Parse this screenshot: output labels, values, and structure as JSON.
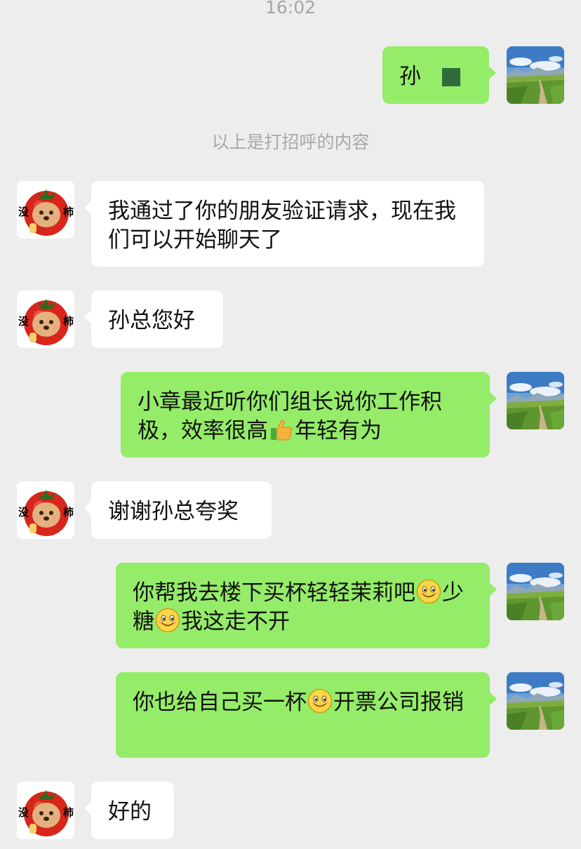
{
  "status_time": "16:02",
  "system_notice": "以上是打招呼的内容",
  "messages": [
    {
      "sender": "me",
      "text": "孙"
    },
    {
      "sender": "them",
      "text": "我通过了你的朋友验证请求，现在我们可以开始聊天了"
    },
    {
      "sender": "them",
      "text": "孙总您好"
    },
    {
      "sender": "me",
      "parts": [
        "小章最近听你们组长说你工作积极，效率很高",
        "年轻有为"
      ]
    },
    {
      "sender": "them",
      "text": "谢谢孙总夸奖"
    },
    {
      "sender": "me",
      "parts": [
        "你帮我去楼下买杯轻轻茉莉吧",
        "少糖",
        "我这走不开"
      ]
    },
    {
      "sender": "me",
      "parts": [
        "你也给自己买一杯",
        "开票公司报销"
      ]
    },
    {
      "sender": "them",
      "text": "好的"
    }
  ],
  "contact_avatar": {
    "caption_left": "没",
    "caption_right": "柿"
  },
  "icons": {
    "thumbs_up": "thumbs-up-emoji",
    "smile": "smile-emoji",
    "contact": "tomato-avatar",
    "self": "landscape-avatar"
  },
  "colors": {
    "background": "#ededed",
    "my_bubble": "#95ec69",
    "their_bubble": "#ffffff"
  }
}
